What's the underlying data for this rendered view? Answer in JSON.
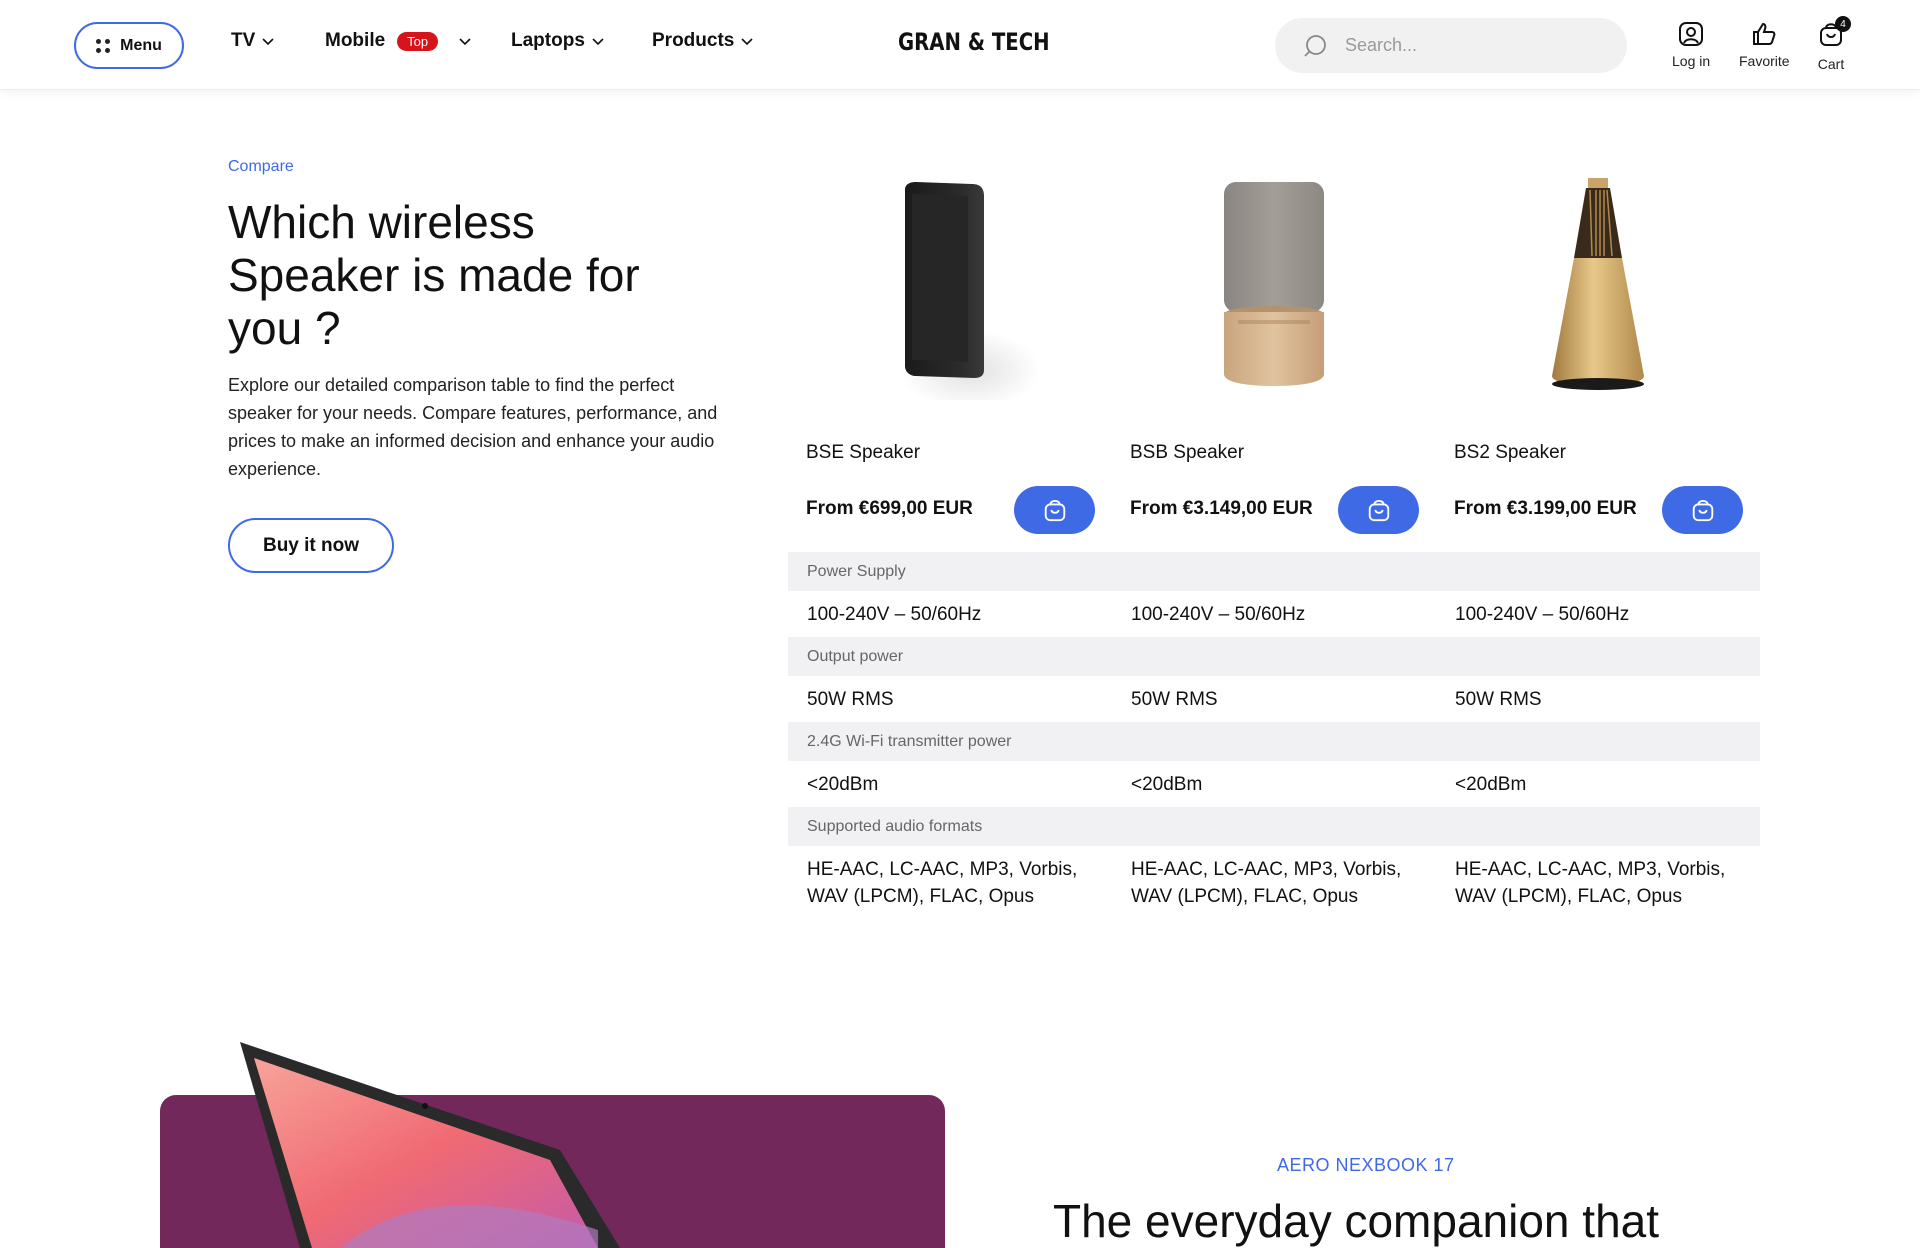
{
  "header": {
    "menu_label": "Menu",
    "nav": [
      {
        "label": "TV"
      },
      {
        "label": "Mobile",
        "badge": "Top"
      },
      {
        "label": "Laptops"
      },
      {
        "label": "Products"
      }
    ],
    "logo": "GRAN & TECH",
    "search_placeholder": "Search...",
    "actions": {
      "login": "Log in",
      "favorite": "Favorite",
      "cart": "Cart",
      "cart_count": "4"
    }
  },
  "compare": {
    "eyebrow": "Compare",
    "title": "Which wireless Speaker is made for you ?",
    "description": "Explore our detailed comparison table to find the perfect speaker for your needs. Compare features, performance, and prices to make an informed decision and enhance your audio experience.",
    "buy_button": "Buy it now",
    "products": [
      {
        "name": "BSE Speaker",
        "price": "From €699,00 EUR"
      },
      {
        "name": "BSB Speaker",
        "price": "From €3.149,00 EUR"
      },
      {
        "name": "BS2 Speaker",
        "price": "From €3.199,00 EUR"
      }
    ],
    "specs": [
      {
        "label": "Power Supply",
        "values": [
          "100-240V – 50/60Hz",
          "100-240V – 50/60Hz",
          "100-240V – 50/60Hz"
        ]
      },
      {
        "label": "Output power",
        "values": [
          "50W RMS",
          "50W RMS",
          "50W RMS"
        ]
      },
      {
        "label": "2.4G Wi-Fi transmitter power",
        "values": [
          "<20dBm",
          "<20dBm",
          "<20dBm"
        ]
      },
      {
        "label": "Supported audio formats",
        "values": [
          "HE-AAC, LC-AAC, MP3, Vorbis, WAV (LPCM), FLAC, Opus",
          "HE-AAC, LC-AAC, MP3, Vorbis, WAV (LPCM), FLAC, Opus",
          "HE-AAC, LC-AAC, MP3, Vorbis, WAV (LPCM), FLAC, Opus"
        ]
      }
    ]
  },
  "laptop": {
    "eyebrow": "AERO NEXBOOK 17",
    "title": "The everyday companion that"
  },
  "colors": {
    "accent": "#3f6ae6",
    "badge_red": "#d6141c",
    "laptop_card": "#73285b",
    "spec_header_bg": "#f1f1f3"
  },
  "icons": [
    "menu-dots-icon",
    "chevron-down-icon",
    "search-icon",
    "user-icon",
    "thumbs-up-icon",
    "cart-icon",
    "shopping-bag-icon"
  ]
}
